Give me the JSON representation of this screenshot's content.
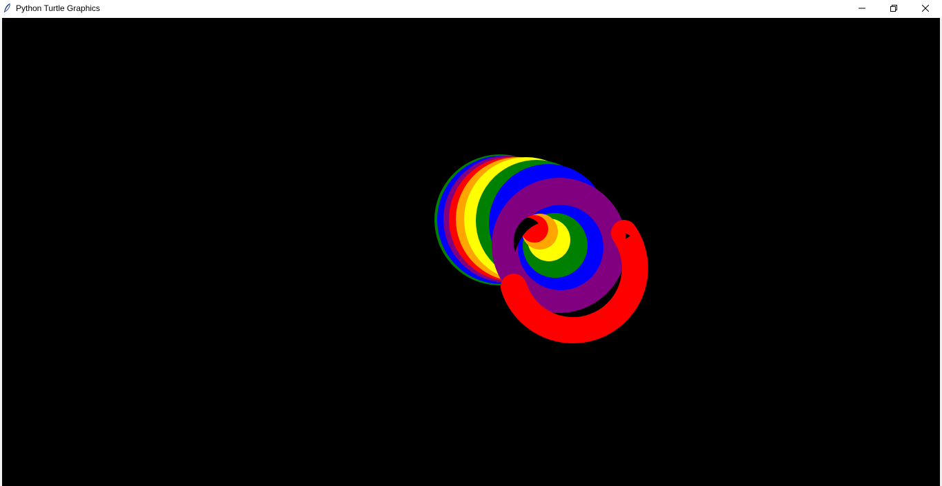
{
  "window": {
    "title": "Python Turtle Graphics",
    "icon": "feather-icon",
    "controls": {
      "minimize_icon": "minimize-icon",
      "restore_icon": "restore-icon",
      "close_icon": "close-icon"
    }
  },
  "canvas": {
    "background": "#000000",
    "drawing": "rainbow spiral of thick colored arcs",
    "pen_colors": [
      "#ff0000",
      "#ffa500",
      "#ffff00",
      "#008000",
      "#0000ff",
      "#800080"
    ],
    "turtle_icon": "turtle-arrow-icon"
  }
}
